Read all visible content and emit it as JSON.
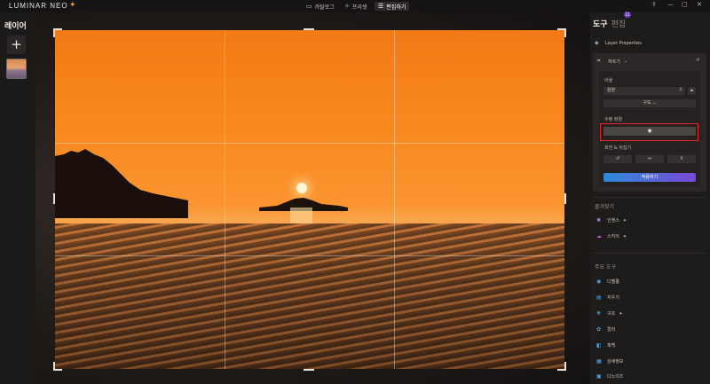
{
  "app": {
    "logo_text": "LUMINAR NEO",
    "brand_color": "#f0a23a"
  },
  "topbar": {
    "tabs": [
      {
        "label": "카탈로그",
        "icon": "folder-icon",
        "active": false
      },
      {
        "label": "프리셋",
        "icon": "sparkle-icon",
        "active": false
      },
      {
        "label": "편집하기",
        "icon": "sliders-icon",
        "active": true
      }
    ],
    "window_controls": [
      "share-icon",
      "minimize-icon",
      "maximize-icon",
      "close-icon"
    ]
  },
  "left_panel": {
    "title": "레이어",
    "add_label": "+"
  },
  "right_panel": {
    "tab_tools": "도구",
    "tab_edit": "편집",
    "edit_badge": "11",
    "layer_properties": "Layer Properties",
    "crop": {
      "title": "자르기",
      "ratio_label": "비율",
      "ratio_value": "원본",
      "composition_button": "구도",
      "level_label": "수평 정렬",
      "rotate_label": "회전 & 뒤집기",
      "rotate_buttons": [
        "↺",
        "⇔",
        "⇕"
      ],
      "apply_button": "적용하기"
    },
    "favorites": {
      "title": "즐겨찾기",
      "items": [
        "인핸스",
        "스카이"
      ]
    },
    "essentials": {
      "title": "주요 도구",
      "items": [
        "디벨롭",
        "지우기",
        "구조",
        "컬러",
        "흑백",
        "상세정보",
        "디노이즈"
      ]
    }
  }
}
